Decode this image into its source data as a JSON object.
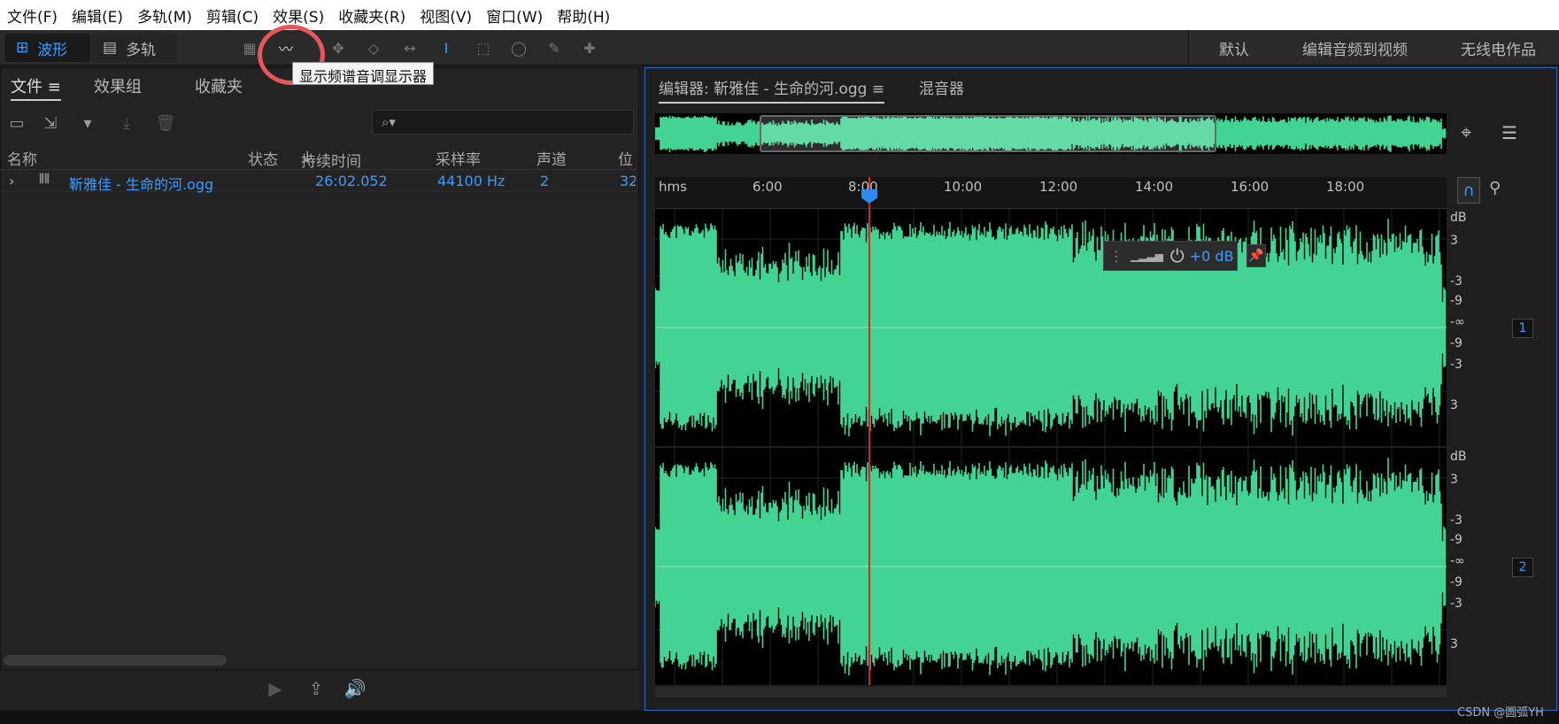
{
  "menu": [
    "文件(F)",
    "编辑(E)",
    "多轨(M)",
    "剪辑(C)",
    "效果(S)",
    "收藏夹(R)",
    "视图(V)",
    "窗口(W)",
    "帮助(H)"
  ],
  "toolbar": {
    "mode_waveform": "波形",
    "mode_multitrack": "多轨",
    "tooltip": "显示频谱音调显示器"
  },
  "workspaces": [
    "默认",
    "编辑音频到视频",
    "无线电作品"
  ],
  "left_panel": {
    "tabs": [
      "文件",
      "效果组",
      "收藏夹"
    ],
    "columns": [
      "名称",
      "状态",
      "持续时间",
      "采样率",
      "声道",
      "位"
    ],
    "file": {
      "name": "靳雅佳 - 生命的河.ogg",
      "duration": "26:02.052",
      "sample_rate": "44100 Hz",
      "channels": "2",
      "bit": "32"
    }
  },
  "editor": {
    "tab_editor": "编辑器: 靳雅佳 - 生命的河.ogg",
    "tab_mixer": "混音器",
    "ruler_unit": "hms",
    "ruler_ticks": [
      "6:00",
      "8:00",
      "10:00",
      "12:00",
      "14:00",
      "16:00",
      "18:00"
    ],
    "db_unit": "dB",
    "db_labels": [
      "3",
      "-3",
      "-9",
      "-∞",
      "-9",
      "-3",
      "3"
    ],
    "channels": [
      "1",
      "2"
    ],
    "hud_value": "+0 dB"
  },
  "credit": "CSDN @圆弧YH"
}
